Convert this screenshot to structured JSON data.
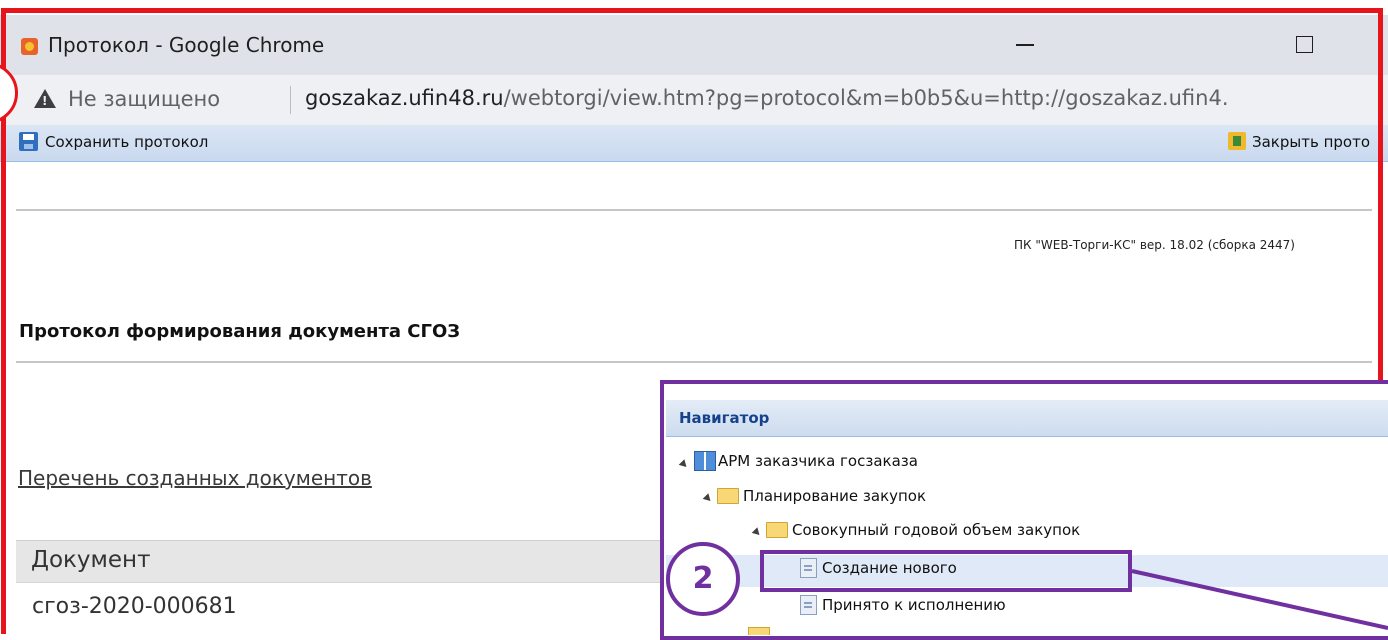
{
  "window": {
    "title": "Протокол - Google Chrome",
    "controls": [
      "minimize",
      "maximize"
    ]
  },
  "address_bar": {
    "security_label": "Не защищено",
    "url_host": "goszakaz.ufin48.ru",
    "url_rest": "/webtorgi/view.htm?pg=protocol&m=b0b5&u=http://goszakaz.ufin4."
  },
  "toolbar": {
    "save_label": "Сохранить протокол",
    "close_label": "Закрыть прото"
  },
  "page": {
    "version": "ПК \"WEB-Торги-КС\" вер. 18.02 (сборка 2447)",
    "title": "Протокол формирования документа СГОЗ",
    "docs_link": "Перечень созданных документов",
    "table": {
      "header": "Документ",
      "rows": [
        "сгоз-2020-000681"
      ]
    }
  },
  "navigator": {
    "title": "Навигатор",
    "items": [
      {
        "label": "АРМ заказчика госзаказа",
        "level": 0,
        "kind": "root"
      },
      {
        "label": "Планирование закупок",
        "level": 1,
        "kind": "folder"
      },
      {
        "label": "Совокупный годовой объем закупок",
        "level": 2,
        "kind": "folder"
      },
      {
        "label": "Создание нового",
        "level": 3,
        "kind": "document",
        "selected": true
      },
      {
        "label": "Принято к исполнению",
        "level": 3,
        "kind": "document"
      }
    ]
  },
  "callout": {
    "number": "2"
  },
  "colors": {
    "frame_red": "#e8141c",
    "callout_purple": "#7030a0",
    "toolbar_blue": "#c9d9ee",
    "nav_title": "#15428b"
  }
}
